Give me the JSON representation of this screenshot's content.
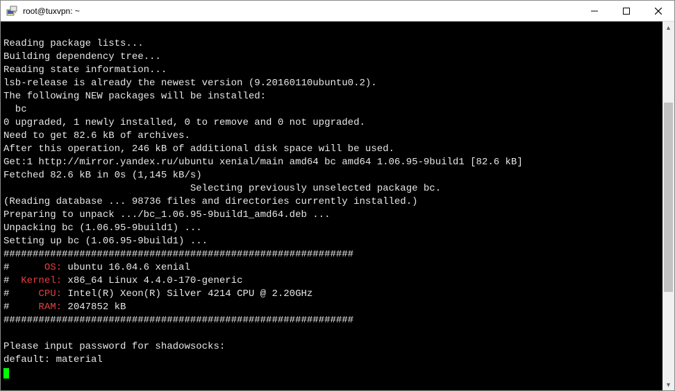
{
  "window": {
    "title": "root@tuxvpn: ~"
  },
  "terminal": {
    "lines": [
      {
        "segments": [
          {
            "text": ""
          }
        ]
      },
      {
        "segments": [
          {
            "text": "Reading package lists..."
          }
        ]
      },
      {
        "segments": [
          {
            "text": "Building dependency tree..."
          }
        ]
      },
      {
        "segments": [
          {
            "text": "Reading state information..."
          }
        ]
      },
      {
        "segments": [
          {
            "text": "lsb-release is already the newest version (9.20160110ubuntu0.2)."
          }
        ]
      },
      {
        "segments": [
          {
            "text": "The following NEW packages will be installed:"
          }
        ]
      },
      {
        "segments": [
          {
            "text": "  bc"
          }
        ]
      },
      {
        "segments": [
          {
            "text": "0 upgraded, 1 newly installed, 0 to remove and 0 not upgraded."
          }
        ]
      },
      {
        "segments": [
          {
            "text": "Need to get 82.6 kB of archives."
          }
        ]
      },
      {
        "segments": [
          {
            "text": "After this operation, 246 kB of additional disk space will be used."
          }
        ]
      },
      {
        "segments": [
          {
            "text": "Get:1 http://mirror.yandex.ru/ubuntu xenial/main amd64 bc amd64 1.06.95-9build1 [82.6 kB]"
          }
        ]
      },
      {
        "segments": [
          {
            "text": "Fetched 82.6 kB in 0s (1,145 kB/s)"
          }
        ]
      },
      {
        "segments": [
          {
            "text": "                                Selecting previously unselected package bc."
          }
        ]
      },
      {
        "segments": [
          {
            "text": "(Reading database ... 98736 files and directories currently installed.)"
          }
        ]
      },
      {
        "segments": [
          {
            "text": "Preparing to unpack .../bc_1.06.95-9build1_amd64.deb ..."
          }
        ]
      },
      {
        "segments": [
          {
            "text": "Unpacking bc (1.06.95-9build1) ..."
          }
        ]
      },
      {
        "segments": [
          {
            "text": "Setting up bc (1.06.95-9build1) ..."
          }
        ]
      },
      {
        "segments": [
          {
            "text": "############################################################"
          }
        ]
      },
      {
        "segments": [
          {
            "text": "#      "
          },
          {
            "text": "OS:",
            "cls": "red"
          },
          {
            "text": " ubuntu 16.04.6 xenial"
          }
        ]
      },
      {
        "segments": [
          {
            "text": "#  "
          },
          {
            "text": "Kernel:",
            "cls": "red"
          },
          {
            "text": " x86_64 Linux 4.4.0-170-generic"
          }
        ]
      },
      {
        "segments": [
          {
            "text": "#     "
          },
          {
            "text": "CPU:",
            "cls": "red"
          },
          {
            "text": " Intel(R) Xeon(R) Silver 4214 CPU @ 2.20GHz"
          }
        ]
      },
      {
        "segments": [
          {
            "text": "#     "
          },
          {
            "text": "RAM:",
            "cls": "red"
          },
          {
            "text": " 2047852 kB"
          }
        ]
      },
      {
        "segments": [
          {
            "text": "############################################################"
          }
        ]
      },
      {
        "segments": [
          {
            "text": ""
          }
        ]
      },
      {
        "segments": [
          {
            "text": "Please input password for shadowsocks:"
          }
        ]
      },
      {
        "segments": [
          {
            "text": "default: material"
          }
        ]
      }
    ]
  }
}
